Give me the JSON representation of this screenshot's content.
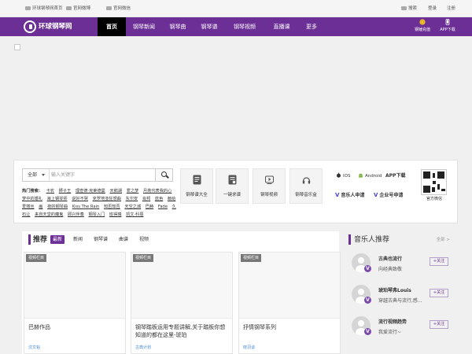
{
  "topbar": {
    "home_link": "环球钢琴网首页",
    "weibo_link": "官网微博",
    "wechat_link": "官网微信",
    "search_link": "搜索",
    "login_link": "登录",
    "register_link": "注册"
  },
  "nav": {
    "logo_text": "环球钢琴网",
    "items": [
      "首页",
      "钢琴新闻",
      "钢琴曲",
      "钢琴谱",
      "钢琴视频",
      "直播课",
      "更多"
    ],
    "active_index": 0,
    "coin_label": "钢锤充值",
    "app_label": "APP下载"
  },
  "search": {
    "scope_label": "全部",
    "placeholder": "输入关键字",
    "hot_label": "热门搜索：",
    "hot_tags": [
      "卡农",
      "狮子王",
      "理查德·克莱德曼",
      "天鹅湖",
      "爱之梦",
      "月亮代表我的心",
      "梦中的婚礼",
      "海上钢琴师",
      "说好不哭",
      "克罗地亚狂想曲",
      "东尔安",
      "肖邦",
      "蓝色",
      "献给爱丽丝",
      "画",
      "夜的钢琴曲",
      "Kiss The Rain",
      "知否知否",
      "天空之城",
      "巴赫",
      "Fade",
      "久石让",
      "来自天堂的魔鬼",
      "即兴伴奏",
      "钢琴入门",
      "班得瑞",
      "凯文·科恩"
    ]
  },
  "categories": [
    {
      "label": "钢琴谱大全",
      "icon": "sheet-icon"
    },
    {
      "label": "一键求谱",
      "icon": "request-icon"
    },
    {
      "label": "钢琴视频",
      "icon": "video-icon"
    },
    {
      "label": "钢琴音乐盒",
      "icon": "headphones-icon"
    }
  ],
  "app": {
    "ios_label": "IOS",
    "android_label": "Android",
    "download_label": "APP下载",
    "musician_apply": "音乐人申请",
    "enterprise_apply": "企业号申请",
    "wechat_label": "官方微信"
  },
  "recommend": {
    "title": "推荐",
    "tabs": [
      "最新",
      "新闻",
      "钢琴谱",
      "曲谱",
      "视频"
    ],
    "active_tab": 0,
    "cards": [
      {
        "badge": "视频栏目",
        "title": "巴赫作品",
        "author": "沈文韬"
      },
      {
        "badge": "视频栏目",
        "title": "钢琴踏板运用专题讲解,关于踏板你想知道的都在这里-琥珀",
        "author": "古典计划"
      },
      {
        "badge": "视频栏目",
        "title": "抒情钢琴系列",
        "author": "晓羽谈"
      }
    ]
  },
  "musicians": {
    "title": "音乐人推荐",
    "more_label": "全部 >",
    "follow_label": "+关注",
    "verified_mark": "V",
    "items": [
      {
        "name": "古典也流行",
        "desc": "向经典致敬"
      },
      {
        "name": "琥珀琴弗Louis",
        "desc": "穿越古典与流行,感..."
      },
      {
        "name": "流行视频趋势",
        "desc": "我爱流行~"
      }
    ]
  },
  "colors": {
    "brand": "#6c2f95",
    "accent_gold": "#f1c232",
    "link_blue": "#4a8bd6",
    "verified_blue": "#4b3fd1"
  }
}
